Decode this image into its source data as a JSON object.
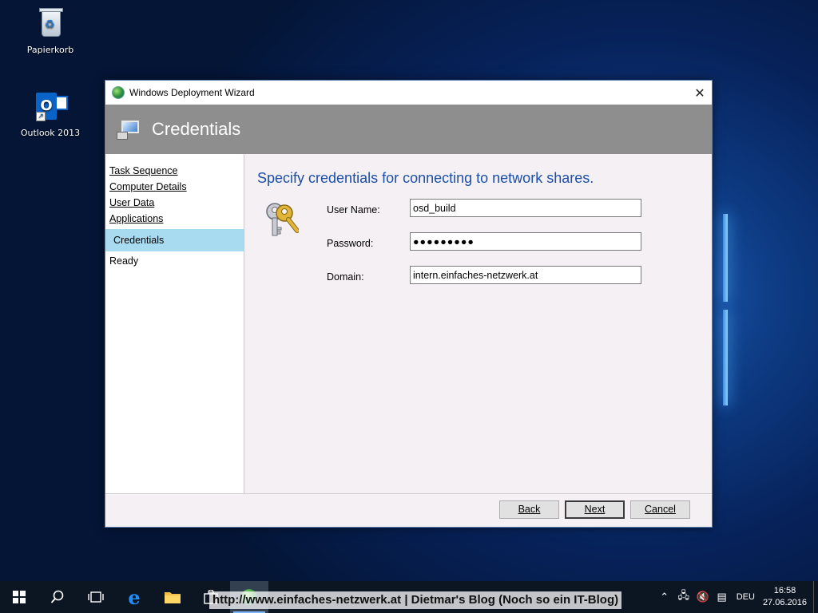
{
  "desktop": {
    "icons": [
      {
        "label": "Papierkorb"
      },
      {
        "label": "Outlook 2013"
      }
    ]
  },
  "window": {
    "title": "Windows Deployment Wizard",
    "close_glyph": "✕",
    "header_title": "Credentials"
  },
  "nav": {
    "items": [
      {
        "label": "Task Sequence",
        "state": "completed"
      },
      {
        "label": "Computer Details",
        "state": "completed"
      },
      {
        "label": "User Data",
        "state": "completed"
      },
      {
        "label": "Applications",
        "state": "completed"
      },
      {
        "label": "Credentials",
        "state": "current"
      },
      {
        "label": "Ready",
        "state": "pending"
      }
    ]
  },
  "content": {
    "heading": "Specify credentials for connecting to network shares.",
    "fields": {
      "user_name": {
        "label": "User Name:",
        "value": "osd_build"
      },
      "password": {
        "label": "Password:",
        "value": "●●●●●●●●●"
      },
      "domain": {
        "label": "Domain:",
        "value": "intern.einfaches-netzwerk.at"
      }
    }
  },
  "buttons": {
    "back": "Back",
    "next": "Next",
    "cancel": "Cancel"
  },
  "taskbar": {
    "watermark": "http://www.einfaches-netzwerk.at | Dietmar's Blog (Noch so ein IT-Blog)",
    "language": "DEU",
    "time": "16:58",
    "date": "27.06.2016"
  },
  "colors": {
    "accent_heading": "#1b4fa8",
    "header_band": "#8e8e8e",
    "nav_selected": "#a8daf0"
  }
}
